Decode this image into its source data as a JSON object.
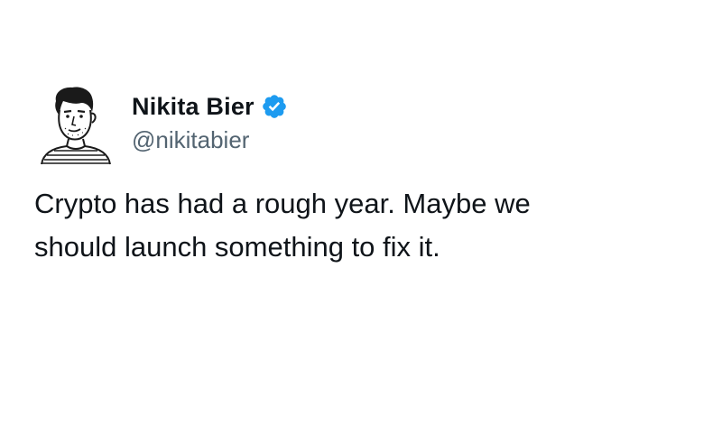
{
  "author": {
    "display_name": "Nikita Bier",
    "handle": "@nikitabier",
    "verified": true,
    "avatar_icon": "sketch-portrait-avatar",
    "verified_icon": "verified-badge-icon"
  },
  "tweet": {
    "lines": [
      "Crypto has had a rough year. Maybe we",
      "should launch something to fix it."
    ]
  },
  "colors": {
    "background": "#ffffff",
    "text": "#0f1419",
    "secondary_text": "#536471",
    "verified_blue": "#1d9bf0"
  }
}
